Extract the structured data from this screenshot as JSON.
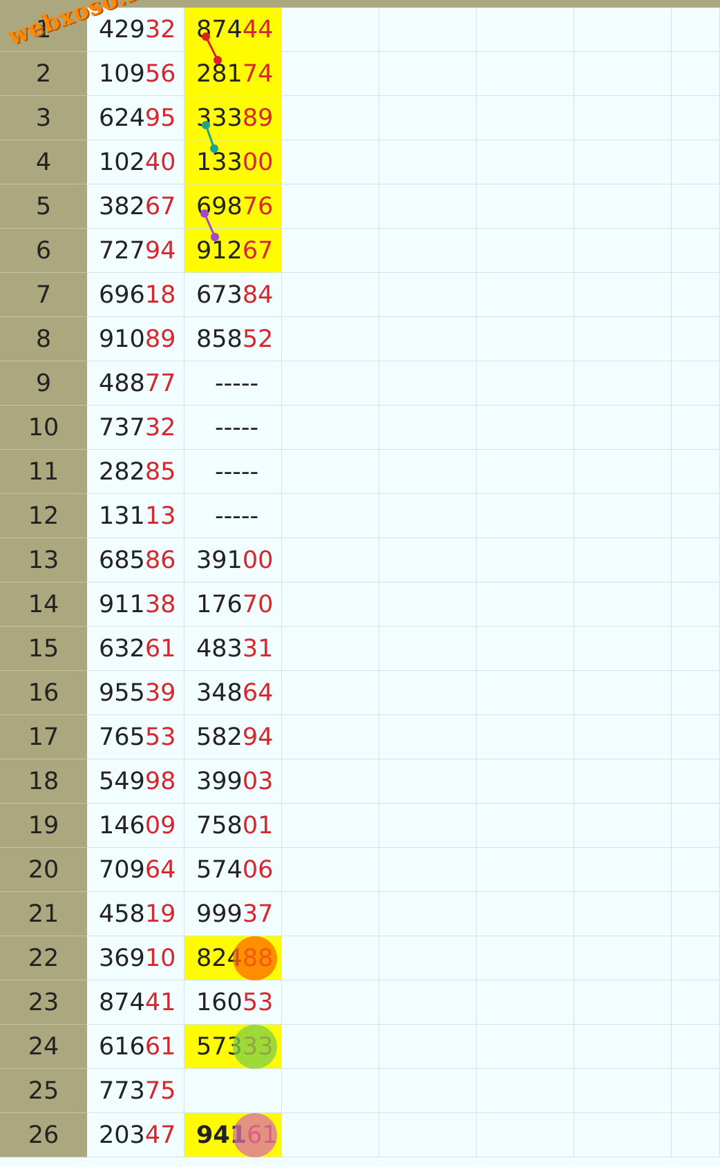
{
  "watermark": "webxoso.net",
  "rows": [
    {
      "n": "1",
      "a_lead": "429",
      "a_tail": "32",
      "b_lead": "874",
      "b_tail": "44",
      "hl": true
    },
    {
      "n": "2",
      "a_lead": "109",
      "a_tail": "56",
      "b_lead": "281",
      "b_tail": "74",
      "hl": true
    },
    {
      "n": "3",
      "a_lead": "624",
      "a_tail": "95",
      "b_lead": "333",
      "b_tail": "89",
      "hl": true
    },
    {
      "n": "4",
      "a_lead": "102",
      "a_tail": "40",
      "b_lead": "133",
      "b_tail": "00",
      "hl": true
    },
    {
      "n": "5",
      "a_lead": "382",
      "a_tail": "67",
      "b_lead": "698",
      "b_tail": "76",
      "hl": true
    },
    {
      "n": "6",
      "a_lead": "727",
      "a_tail": "94",
      "b_lead": "912",
      "b_tail": "67",
      "hl": true
    },
    {
      "n": "7",
      "a_lead": "696",
      "a_tail": "18",
      "b_lead": "673",
      "b_tail": "84"
    },
    {
      "n": "8",
      "a_lead": "910",
      "a_tail": "89",
      "b_lead": "858",
      "b_tail": "52"
    },
    {
      "n": "9",
      "a_lead": "488",
      "a_tail": "77",
      "b_dash": "-----"
    },
    {
      "n": "10",
      "a_lead": "737",
      "a_tail": "32",
      "b_dash": "-----"
    },
    {
      "n": "11",
      "a_lead": "282",
      "a_tail": "85",
      "b_dash": "-----"
    },
    {
      "n": "12",
      "a_lead": "131",
      "a_tail": "13",
      "b_dash": "-----"
    },
    {
      "n": "13",
      "a_lead": "685",
      "a_tail": "86",
      "b_lead": "391",
      "b_tail": "00"
    },
    {
      "n": "14",
      "a_lead": "911",
      "a_tail": "38",
      "b_lead": "176",
      "b_tail": "70"
    },
    {
      "n": "15",
      "a_lead": "632",
      "a_tail": "61",
      "b_lead": "483",
      "b_tail": "31"
    },
    {
      "n": "16",
      "a_lead": "955",
      "a_tail": "39",
      "b_lead": "348",
      "b_tail": "64"
    },
    {
      "n": "17",
      "a_lead": "765",
      "a_tail": "53",
      "b_lead": "582",
      "b_tail": "94"
    },
    {
      "n": "18",
      "a_lead": "549",
      "a_tail": "98",
      "b_lead": "399",
      "b_tail": "03"
    },
    {
      "n": "19",
      "a_lead": "146",
      "a_tail": "09",
      "b_lead": "758",
      "b_tail": "01"
    },
    {
      "n": "20",
      "a_lead": "709",
      "a_tail": "64",
      "b_lead": "574",
      "b_tail": "06"
    },
    {
      "n": "21",
      "a_lead": "458",
      "a_tail": "19",
      "b_lead": "999",
      "b_tail": "37"
    },
    {
      "n": "22",
      "a_lead": "369",
      "a_tail": "10",
      "b_lead": "824",
      "b_tail": "88",
      "hl": true,
      "circle": "#ff6a00"
    },
    {
      "n": "23",
      "a_lead": "874",
      "a_tail": "41",
      "b_lead": "160",
      "b_tail": "53"
    },
    {
      "n": "24",
      "a_lead": "616",
      "a_tail": "61",
      "b_lead": "573",
      "b_tail": "33",
      "hl": true,
      "circle": "#7ccf4a"
    },
    {
      "n": "25",
      "a_lead": "773",
      "a_tail": "75",
      "b_empty": true
    },
    {
      "n": "26",
      "a_lead": "203",
      "a_tail": "47",
      "b_lead": "941",
      "b_tail": "61",
      "hl": true,
      "bold": true,
      "circle": "#d86fa8"
    }
  ],
  "colors": {
    "rownum_bg": "#aba77f",
    "sheet_bg": "#f1fdfe",
    "highlight": "#fffb00",
    "tail_red": "#d6262e",
    "link_red": "#e02020",
    "link_teal": "#1aa58c",
    "link_purple": "#a448c8"
  }
}
